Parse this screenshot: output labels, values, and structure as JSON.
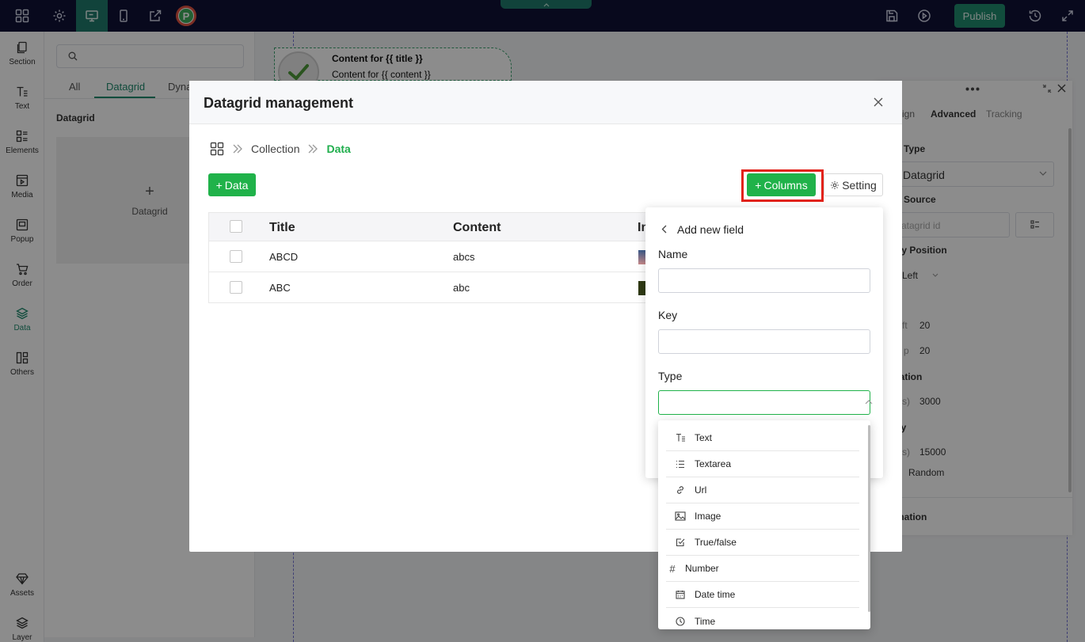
{
  "topbar": {
    "publish_label": "Publish",
    "logo_letter": "P"
  },
  "rail": {
    "items": [
      {
        "label": "Section",
        "icon": "section-icon"
      },
      {
        "label": "Text",
        "icon": "text-icon"
      },
      {
        "label": "Elements",
        "icon": "elements-icon"
      },
      {
        "label": "Media",
        "icon": "media-icon"
      },
      {
        "label": "Popup",
        "icon": "popup-icon"
      },
      {
        "label": "Order",
        "icon": "cart-icon"
      },
      {
        "label": "Data",
        "icon": "layers-icon"
      },
      {
        "label": "Others",
        "icon": "others-icon"
      },
      {
        "label": "Assets",
        "icon": "diamond-icon"
      },
      {
        "label": "Layer",
        "icon": "layer-icon"
      }
    ]
  },
  "left_panel": {
    "search_placeholder": "",
    "tabs": [
      "All",
      "Datagrid",
      "Dyna"
    ],
    "section_title": "Datagrid",
    "card_label": "Datagrid"
  },
  "canvas": {
    "title_text": "Content for {{ title }}",
    "content_text": "Content for {{ content }}"
  },
  "right_panel": {
    "tabs": [
      "ign",
      "Advanced",
      "Tracking"
    ],
    "data_type_label": "a Type",
    "data_type_value": "Datagrid",
    "data_source_label": "a Source",
    "data_source_placeholder": "atagrid id",
    "position_label": "ify Position",
    "position_value": "Left",
    "offset_label": "s",
    "left_label": "ft",
    "left_value": "20",
    "top_label": "p",
    "top_value": "20",
    "duration_label": "ration",
    "duration_unit": "s)",
    "duration_value": "3000",
    "delay_label": "ay",
    "delay_unit": "s)",
    "delay_value": "15000",
    "random_label": "Random",
    "animation_label": "mation"
  },
  "modal": {
    "title": "Datagrid management",
    "breadcrumbs": [
      "Collection",
      "Data"
    ],
    "add_data_label": "Data",
    "add_columns_label": "Columns",
    "setting_label": "Setting",
    "columns": [
      "Title",
      "Content",
      "Im"
    ],
    "rows": [
      {
        "title": "ABCD",
        "content": "abcs"
      },
      {
        "title": "ABC",
        "content": "abc"
      }
    ]
  },
  "popover": {
    "title": "Add new field",
    "name_label": "Name",
    "name_value": "",
    "key_label": "Key",
    "key_value": "",
    "type_label": "Type",
    "type_value": ""
  },
  "type_options": [
    {
      "label": "Text",
      "icon": "text-type-icon"
    },
    {
      "label": "Textarea",
      "icon": "list-icon"
    },
    {
      "label": "Url",
      "icon": "link-icon"
    },
    {
      "label": "Image",
      "icon": "image-icon"
    },
    {
      "label": "True/false",
      "icon": "checkbox-icon"
    },
    {
      "label": "Number",
      "icon": "hash-icon"
    },
    {
      "label": "Date time",
      "icon": "calendar-icon"
    },
    {
      "label": "Time",
      "icon": "clock-icon"
    }
  ],
  "colors": {
    "topbar": "#0f1135",
    "accent": "#1f8a6e",
    "primary_button": "#20b24a",
    "highlight": "#e2231a"
  }
}
